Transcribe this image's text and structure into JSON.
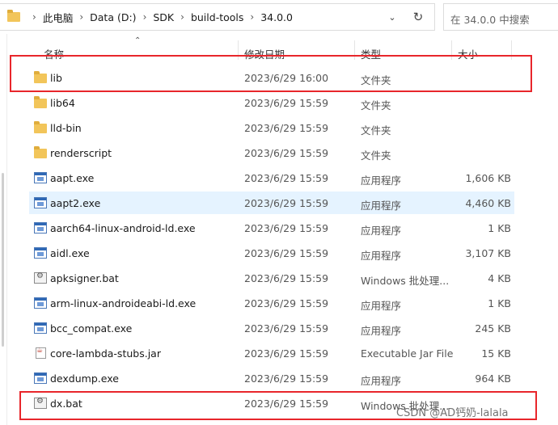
{
  "address": {
    "crumbs": [
      "此电脑",
      "Data (D:)",
      "SDK",
      "build-tools",
      "34.0.0"
    ],
    "separator": "›",
    "dropdown_icon": "chevron-down-icon",
    "refresh_icon": "refresh-icon"
  },
  "search": {
    "placeholder": "在 34.0.0 中搜索"
  },
  "columns": {
    "name": "名称",
    "date": "修改日期",
    "type": "类型",
    "size": "大小"
  },
  "files": [
    {
      "name": "lib",
      "date": "2023/6/29 16:00",
      "type": "文件夹",
      "size": "",
      "icon": "folder-icon"
    },
    {
      "name": "lib64",
      "date": "2023/6/29 15:59",
      "type": "文件夹",
      "size": "",
      "icon": "folder-icon"
    },
    {
      "name": "lld-bin",
      "date": "2023/6/29 15:59",
      "type": "文件夹",
      "size": "",
      "icon": "folder-icon"
    },
    {
      "name": "renderscript",
      "date": "2023/6/29 15:59",
      "type": "文件夹",
      "size": "",
      "icon": "folder-icon"
    },
    {
      "name": "aapt.exe",
      "date": "2023/6/29 15:59",
      "type": "应用程序",
      "size": "1,606 KB",
      "icon": "exe-icon"
    },
    {
      "name": "aapt2.exe",
      "date": "2023/6/29 15:59",
      "type": "应用程序",
      "size": "4,460 KB",
      "icon": "exe-icon"
    },
    {
      "name": "aarch64-linux-android-ld.exe",
      "date": "2023/6/29 15:59",
      "type": "应用程序",
      "size": "1 KB",
      "icon": "exe-icon"
    },
    {
      "name": "aidl.exe",
      "date": "2023/6/29 15:59",
      "type": "应用程序",
      "size": "3,107 KB",
      "icon": "exe-icon"
    },
    {
      "name": "apksigner.bat",
      "date": "2023/6/29 15:59",
      "type": "Windows 批处理...",
      "size": "4 KB",
      "icon": "bat-icon"
    },
    {
      "name": "arm-linux-androideabi-ld.exe",
      "date": "2023/6/29 15:59",
      "type": "应用程序",
      "size": "1 KB",
      "icon": "exe-icon"
    },
    {
      "name": "bcc_compat.exe",
      "date": "2023/6/29 15:59",
      "type": "应用程序",
      "size": "245 KB",
      "icon": "exe-icon"
    },
    {
      "name": "core-lambda-stubs.jar",
      "date": "2023/6/29 15:59",
      "type": "Executable Jar File",
      "size": "15 KB",
      "icon": "jar-icon"
    },
    {
      "name": "dexdump.exe",
      "date": "2023/6/29 15:59",
      "type": "应用程序",
      "size": "964 KB",
      "icon": "exe-icon"
    },
    {
      "name": "dx.bat",
      "date": "2023/6/29 15:59",
      "type": "Windows 批处理...",
      "size": "",
      "icon": "bat-icon"
    }
  ],
  "watermark": "CSDN @AD钙奶-lalala",
  "colors": {
    "highlight": "#e8262b",
    "hover_row": "#e5f3ff",
    "folder": "#f2c55a",
    "exe": "#2f68b5"
  }
}
